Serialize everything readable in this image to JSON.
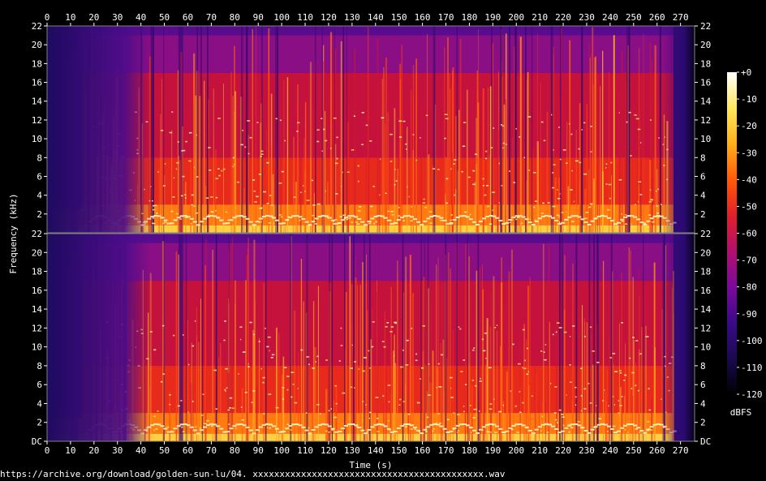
{
  "source": "https://archive.org/download/golden-sun-lu/04. xxxxxxxxxxxxxxxxxxxxxxxxxxxxxxxxxxxxxxxxxxx.wav",
  "chart_data": {
    "type": "heatmap",
    "title": "",
    "xlabel": "Time (s)",
    "ylabel": "Frequency (kHz)",
    "xlim": [
      0,
      276
    ],
    "ylim": [
      0,
      22
    ],
    "x_ticks": [
      0,
      10,
      20,
      30,
      40,
      50,
      60,
      70,
      80,
      90,
      100,
      110,
      120,
      130,
      140,
      150,
      160,
      170,
      180,
      190,
      200,
      210,
      220,
      230,
      240,
      250,
      260,
      270
    ],
    "y_ticks_top": [
      "2",
      "4",
      "6",
      "8",
      "10",
      "12",
      "14",
      "16",
      "18",
      "20",
      "22"
    ],
    "y_ticks_bottom": [
      "DC",
      "2",
      "4",
      "6",
      "8",
      "10",
      "12",
      "14",
      "16",
      "18",
      "20",
      "22"
    ],
    "channels": 2,
    "colorbar": {
      "label": "dBFS",
      "range": [
        -120,
        0
      ],
      "ticks": [
        "+0",
        "-10",
        "-20",
        "-30",
        "-40",
        "-50",
        "-60",
        "-70",
        "-80",
        "-90",
        "-100",
        "-110",
        "-120"
      ],
      "colors": [
        "#000000",
        "#1a0a4e",
        "#3a0a8a",
        "#7a0a9a",
        "#b0106e",
        "#e0202a",
        "#ff5a0a",
        "#ffb01a",
        "#ffe860",
        "#ffffff"
      ]
    },
    "grid": false
  }
}
